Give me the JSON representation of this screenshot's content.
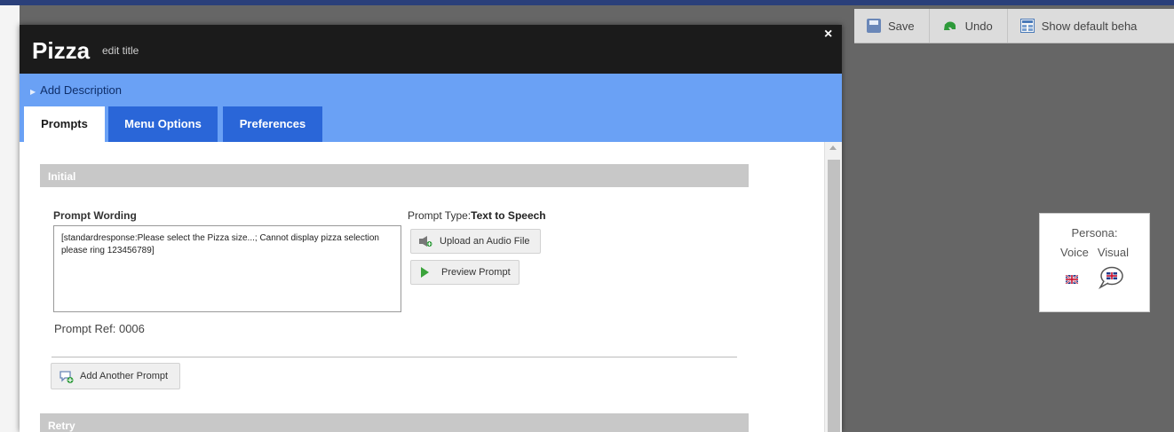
{
  "dialog": {
    "title": "Pizza",
    "edit_title_label": "edit title",
    "close_label": "×",
    "add_description_label": "Add Description",
    "tabs": [
      {
        "label": "Prompts",
        "active": true
      },
      {
        "label": "Menu Options",
        "active": false
      },
      {
        "label": "Preferences",
        "active": false
      }
    ],
    "sections": {
      "initial_label": "Initial",
      "retry_label": "Retry"
    },
    "prompt_wording_label": "Prompt Wording",
    "prompt_wording_value": "[standardresponse:Please select the Pizza size...; Cannot display pizza selection please ring 123456789]",
    "prompt_type_label": "Prompt Type:",
    "prompt_type_value": "Text to Speech",
    "upload_audio_label": "Upload an Audio File",
    "preview_prompt_label": "Preview Prompt",
    "prompt_ref": "Prompt Ref: 0006",
    "add_another_prompt_label": "Add Another Prompt"
  },
  "toolbar": {
    "save_label": "Save",
    "undo_label": "Undo",
    "show_default_label": "Show default beha"
  },
  "persona": {
    "label": "Persona:",
    "voice_label": "Voice",
    "visual_label": "Visual"
  },
  "colors": {
    "header_bg": "#1b1b1b",
    "blue_band": "#6aa1f5",
    "tab_inactive": "#2a66d8",
    "section_bar": "#c8c8c8",
    "overlay": "#666666"
  },
  "icons": [
    "save-icon",
    "undo-icon",
    "grid-icon",
    "uk-flag-icon",
    "speech-bubble-flag-icon",
    "speaker-icon",
    "play-icon",
    "add-prompt-icon",
    "close-icon",
    "expand-triangle-icon"
  ]
}
